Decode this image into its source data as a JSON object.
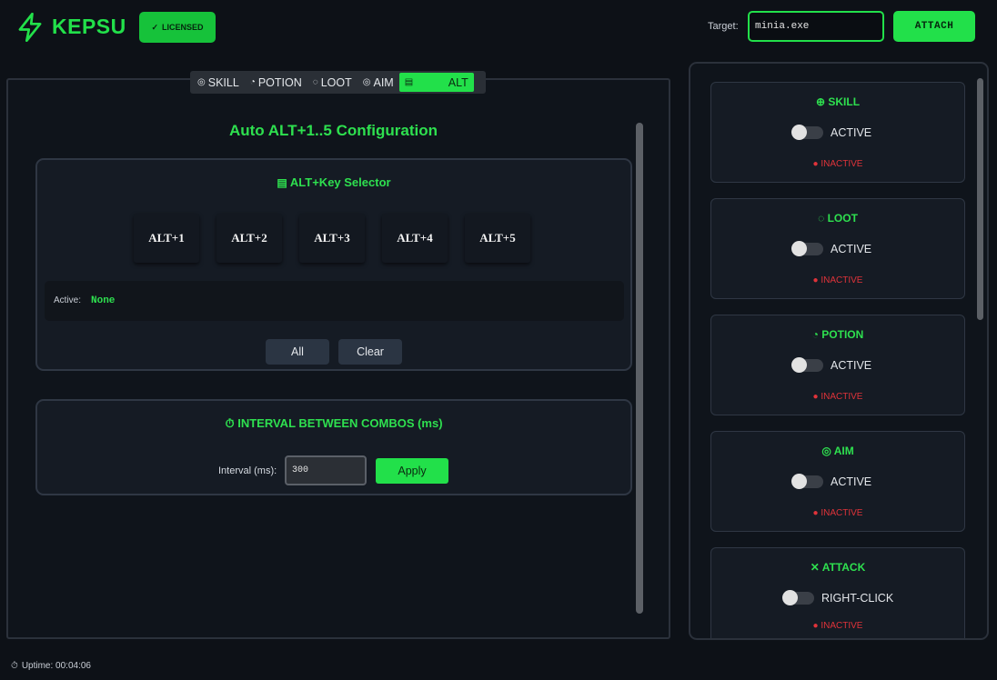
{
  "header": {
    "app_name": "KEPSU",
    "licensed_label": "LICENSED",
    "licensed_check": "✓",
    "target_label": "Target:",
    "target_value": "minia.exe",
    "attach_label": "ATTACH"
  },
  "tabs": [
    {
      "label": "SKILL",
      "icon": "target-icon"
    },
    {
      "label": "POTION",
      "icon": "potion-icon"
    },
    {
      "label": "LOOT",
      "icon": "bag-icon"
    },
    {
      "label": "AIM",
      "icon": "target-icon"
    },
    {
      "label": "ALT",
      "icon": "keyboard-icon",
      "active": true
    }
  ],
  "main": {
    "title": "Auto ALT+1..5 Configuration",
    "key_selector": {
      "title": "ALT+Key Selector",
      "keys": [
        "ALT+1",
        "ALT+2",
        "ALT+3",
        "ALT+4",
        "ALT+5"
      ],
      "active_label": "Active:",
      "active_value": "None",
      "all_label": "All",
      "clear_label": "Clear"
    },
    "interval": {
      "title": "INTERVAL BETWEEN COMBOS (ms)",
      "label": "Interval (ms):",
      "value": "300",
      "apply_label": "Apply"
    }
  },
  "modules": [
    {
      "title": "SKILL",
      "icon": "gamepad-icon",
      "toggle_label": "ACTIVE",
      "status": "● INACTIVE"
    },
    {
      "title": "LOOT",
      "icon": "bag-icon",
      "toggle_label": "ACTIVE",
      "status": "● INACTIVE"
    },
    {
      "title": "POTION",
      "icon": "potion-icon",
      "toggle_label": "ACTIVE",
      "status": "● INACTIVE"
    },
    {
      "title": "AIM",
      "icon": "target-icon",
      "toggle_label": "ACTIVE",
      "status": "● INACTIVE"
    },
    {
      "title": "ATTACK",
      "icon": "swords-icon",
      "toggle_label": "RIGHT-CLICK",
      "status": "● INACTIVE"
    }
  ],
  "footer": {
    "uptime_label": "Uptime: 00:04:06"
  },
  "colors": {
    "accent": "#22e04a",
    "background": "#0d1117",
    "inactive": "#e0333a"
  }
}
